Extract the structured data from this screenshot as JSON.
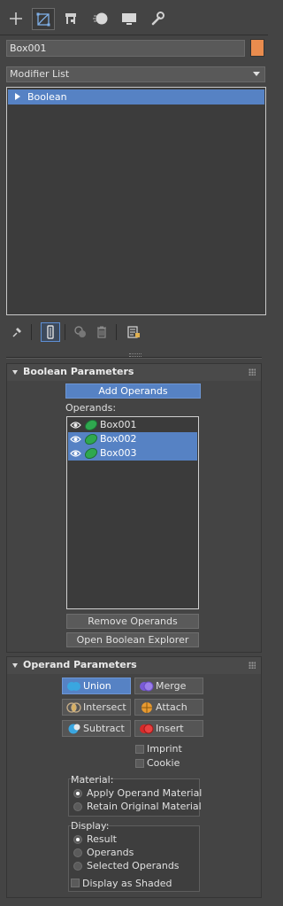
{
  "tabs": [
    {
      "name": "create",
      "icon": "plus-icon"
    },
    {
      "name": "modify",
      "icon": "modify-icon",
      "active": true
    },
    {
      "name": "hierarchy",
      "icon": "hierarchy-icon"
    },
    {
      "name": "motion",
      "icon": "motion-icon"
    },
    {
      "name": "display",
      "icon": "display-icon"
    },
    {
      "name": "utilities",
      "icon": "wrench-icon"
    }
  ],
  "object": {
    "name": "Box001",
    "color": "#e98c4e"
  },
  "modifier_list": {
    "label": "Modifier List"
  },
  "stack": {
    "items": [
      {
        "label": "Boolean",
        "selected": true
      }
    ]
  },
  "stack_tools": [
    "pin-stack-icon",
    "show-end-result-icon",
    "make-unique-icon",
    "remove-modifier-icon",
    "configure-modifier-sets-icon"
  ],
  "boolean_parameters": {
    "title": "Boolean Parameters",
    "add_operands": "Add Operands",
    "operands_label": "Operands:",
    "operands": [
      {
        "name": "Box001",
        "selected": false
      },
      {
        "name": "Box002",
        "selected": true
      },
      {
        "name": "Box003",
        "selected": true
      }
    ],
    "remove_operands": "Remove Operands",
    "open_explorer": "Open Boolean Explorer"
  },
  "operand_parameters": {
    "title": "Operand Parameters",
    "ops": {
      "union": "Union",
      "merge": "Merge",
      "intersect": "Intersect",
      "attach": "Attach",
      "subtract": "Subtract",
      "insert": "Insert"
    },
    "active_op": "Union",
    "imprint": "Imprint",
    "cookie": "Cookie",
    "material": {
      "label": "Material:",
      "options": [
        "Apply Operand Material",
        "Retain Original Material"
      ],
      "selected": "Apply Operand Material"
    },
    "display": {
      "label": "Display:",
      "options": [
        "Result",
        "Operands",
        "Selected Operands"
      ],
      "selected": "Result",
      "shaded": "Display as Shaded"
    }
  },
  "colors": {
    "accent": "#5682c4",
    "panel": "#444444"
  }
}
